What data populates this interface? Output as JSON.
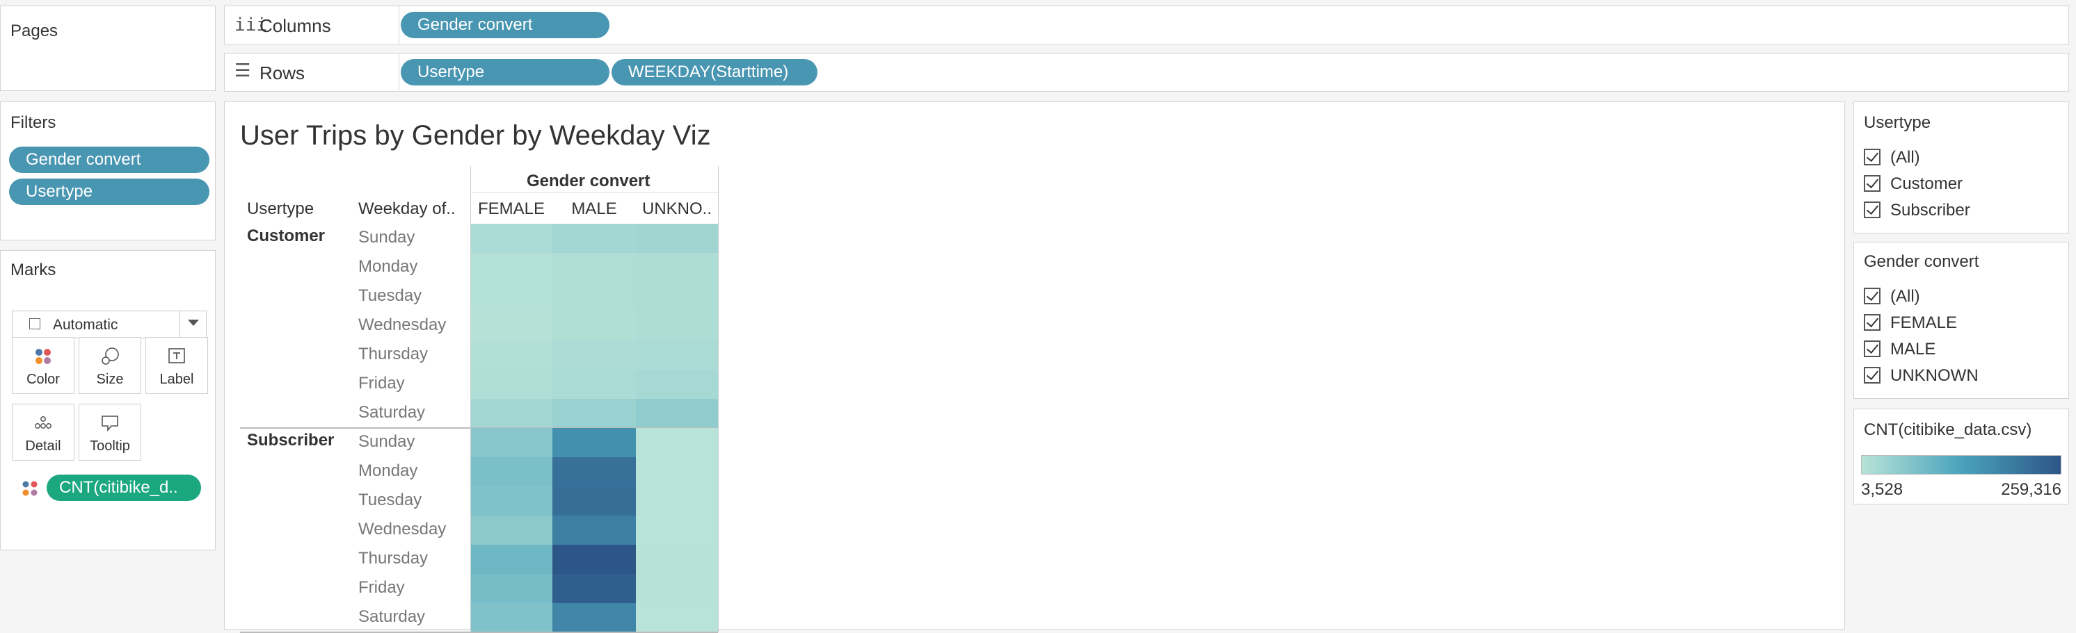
{
  "shelves": {
    "pages_title": "Pages",
    "columns_label": "Columns",
    "columns_pills": [
      "Gender convert"
    ],
    "rows_label": "Rows",
    "rows_pills": [
      "Usertype",
      "WEEKDAY(Starttime)"
    ]
  },
  "filters": {
    "title": "Filters",
    "pills": [
      "Gender convert",
      "Usertype"
    ]
  },
  "marks": {
    "title": "Marks",
    "mark_type": "Automatic",
    "buttons": [
      "Color",
      "Size",
      "Label",
      "Detail",
      "Tooltip"
    ],
    "field_pill": "CNT(citibike_d.."
  },
  "viz": {
    "title": "User Trips by Gender by Weekday Viz",
    "column_group_header": "Gender convert",
    "row_header_1": "Usertype",
    "row_header_2": "Weekday of..",
    "col_headers": [
      "FEMALE",
      "MALE",
      "UNKNO.."
    ]
  },
  "legend_usertype": {
    "title": "Usertype",
    "items": [
      "(All)",
      "Customer",
      "Subscriber"
    ]
  },
  "legend_gender": {
    "title": "Gender convert",
    "items": [
      "(All)",
      "FEMALE",
      "MALE",
      "UNKNOWN"
    ]
  },
  "color_legend": {
    "title": "CNT(citibike_data.csv)",
    "min_label": "3,528",
    "max_label": "259,316",
    "min_color": "#b8e3d8",
    "mid_color": "#4aa3bc",
    "max_color": "#2d5688"
  },
  "chart_data": {
    "type": "heatmap",
    "title": "User Trips by Gender by Weekday Viz",
    "measure": "CNT(citibike_data.csv)",
    "columns": [
      "FEMALE",
      "MALE",
      "UNKNO.."
    ],
    "color_range": [
      3528,
      259316
    ],
    "groups": [
      {
        "usertype": "Customer",
        "rows": [
          {
            "day": "Sunday",
            "values": [
              20000,
              28000,
              32000
            ]
          },
          {
            "day": "Monday",
            "values": [
              8000,
              14000,
              15000
            ]
          },
          {
            "day": "Tuesday",
            "values": [
              8000,
              14000,
              16000
            ]
          },
          {
            "day": "Wednesday",
            "values": [
              7000,
              12000,
              16000
            ]
          },
          {
            "day": "Thursday",
            "values": [
              11000,
              17000,
              20000
            ]
          },
          {
            "day": "Friday",
            "values": [
              14000,
              20000,
              24000
            ]
          },
          {
            "day": "Saturday",
            "values": [
              30000,
              40000,
              50000
            ]
          }
        ]
      },
      {
        "usertype": "Subscriber",
        "rows": [
          {
            "day": "Sunday",
            "values": [
              60000,
              165000,
              4000
            ]
          },
          {
            "day": "Monday",
            "values": [
              75000,
              215000,
              4500
            ]
          },
          {
            "day": "Tuesday",
            "values": [
              70000,
              220000,
              4500
            ]
          },
          {
            "day": "Wednesday",
            "values": [
              55000,
              190000,
              4000
            ]
          },
          {
            "day": "Thursday",
            "values": [
              90000,
              259316,
              5000
            ]
          },
          {
            "day": "Friday",
            "values": [
              80000,
              245000,
              5000
            ]
          },
          {
            "day": "Saturday",
            "values": [
              70000,
              180000,
              4500
            ]
          }
        ]
      }
    ]
  }
}
